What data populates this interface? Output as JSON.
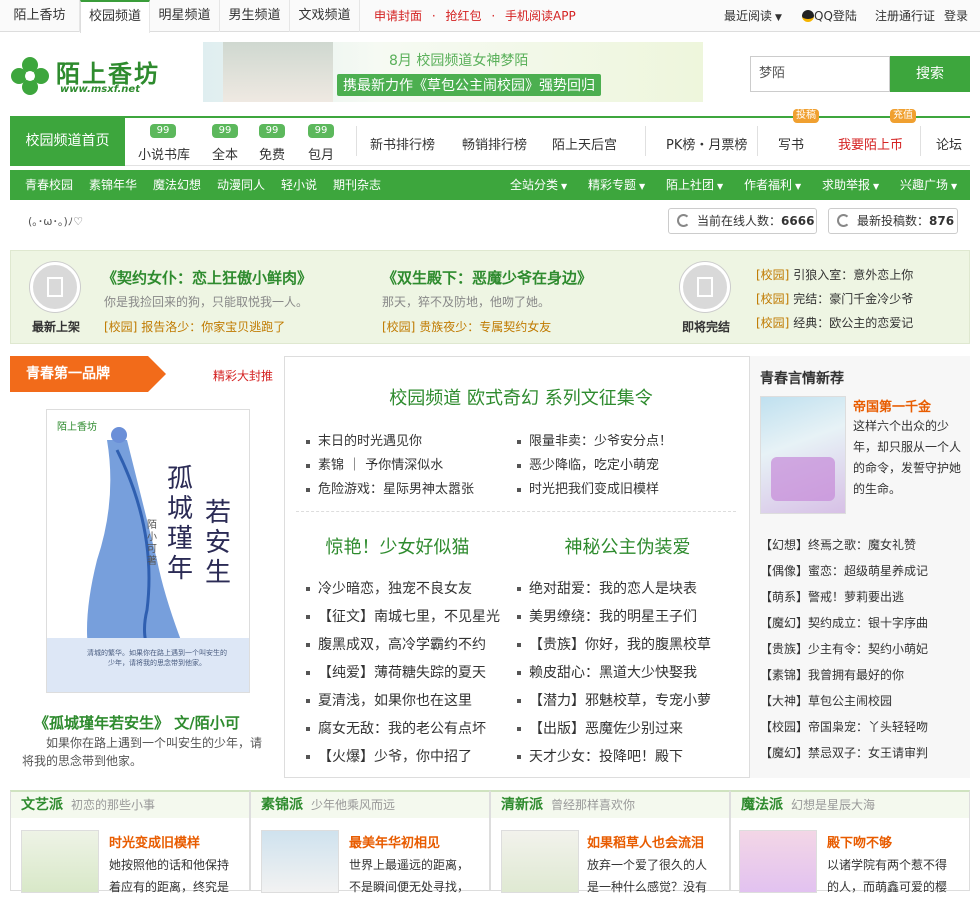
{
  "topbar": {
    "tabs": [
      "陌上香坊",
      "校园频道",
      "明星频道",
      "男生频道",
      "文戏频道"
    ],
    "promo_links": [
      "申请封面",
      "抢红包",
      "手机阅读APP"
    ],
    "right": [
      "最近阅读",
      "QQ登陆",
      "注册通行证",
      "登录"
    ]
  },
  "header": {
    "logo_cn": "陌上香坊",
    "logo_url_text": "www.msxf.net",
    "banner_line1": "8月 校园频道女神梦陌",
    "banner_line2": "携最新力作《草包公主闹校园》强势回归",
    "search_value": "梦陌",
    "search_button": "搜索"
  },
  "nav1": {
    "home": "校园频道首页",
    "items_with_badge": [
      {
        "label": "小说书库",
        "badge": "99"
      },
      {
        "label": "全本",
        "badge": "99"
      },
      {
        "label": "免费",
        "badge": "99"
      },
      {
        "label": "包月",
        "badge": "99"
      }
    ],
    "items": [
      "新书排行榜",
      "畅销排行榜",
      "陌上天后宫",
      "PK榜・月票榜",
      "写书",
      "我要陌上币",
      "论坛"
    ],
    "badge_write": "投稿",
    "badge_coin": "充值"
  },
  "nav2": {
    "left": [
      "青春校园",
      "素锦年华",
      "魔法幻想",
      "动漫同人",
      "轻小说",
      "期刊杂志"
    ],
    "right": [
      "全站分类",
      "精彩专题",
      "陌上社团",
      "作者福利",
      "求助举报",
      "兴趣广场"
    ]
  },
  "status": {
    "emoticon": "(｡･ω･｡)ﾉ♡",
    "online_label": "当前在线人数：",
    "online_count": "6666",
    "posts_label": "最新投稿数：",
    "posts_count": "876"
  },
  "promo": {
    "left_label": "最新上架",
    "right_label": "即将完结",
    "book1_title": "《契约女仆：恋上狂傲小鲜肉》",
    "book1_desc": "你是我捡回来的狗，只能取悦我一人。",
    "book1_tag": "[校园]",
    "book1_tag_text": "报告洛少：你家宝贝逃跑了",
    "book2_title": "《双生殿下：恶魔少爷在身边》",
    "book2_desc": "那天，猝不及防地，他吻了她。",
    "book2_tag": "[校园]",
    "book2_tag_text": "贵族夜少：专属契约女友",
    "right_list": [
      {
        "tag": "[校园]",
        "text": "引狼入室：意外恋上你"
      },
      {
        "tag": "[校园]",
        "text": "完结：豪门千金冷少爷"
      },
      {
        "tag": "[校园]",
        "text": "经典：欧公主的恋爱记"
      }
    ]
  },
  "featured": {
    "ribbon": "青春第一品牌",
    "more": "精彩大封推",
    "cover_publisher": "陌上香坊",
    "cover_title_a": "孤城瑾年",
    "cover_title_b": "若安生",
    "cover_author": "陌小可著",
    "cover_blurb": "清城的繁华。如果你在路上遇到一个叫安生的少年，请将我的思念带到他家。",
    "title": "《孤城瑾年若安生》 文/陌小可",
    "desc": "如果你在路上遇到一个叫安生的少年，请将我的思念带到他家。"
  },
  "center": {
    "heading": "校园频道 欧式奇幻 系列文征集令",
    "list_left": [
      "末日的时光遇见你",
      "素锦 ｜ 予你情深似水",
      "危险游戏：星际男神太嚣张"
    ],
    "list_right": [
      "限量非卖：少爷安分点！",
      "恶少降临，吃定小萌宠",
      "时光把我们变成旧模样"
    ],
    "sub_left": "惊艳！少女好似猫",
    "sub_right": "神秘公主伪装爱",
    "col_left": [
      "冷少暗恋，独宠不良女友",
      "【征文】南城七里，不见星光",
      "腹黑成双，高冷学霸约不约",
      "【纯爱】薄荷糖失踪的夏天",
      "夏清浅，如果你也在这里",
      "腐女无敌：我的老公有点坏",
      "【火爆】少爷，你中招了"
    ],
    "col_right": [
      "绝对甜爱：我的恋人是块表",
      "美男缭绕：我的明星王子们",
      "【贵族】你好，我的腹黑校草",
      "赖皮甜心：黑道大少快娶我",
      "【潜力】邪魅校草，专宠小萝",
      "【出版】恶魔佐少别过来",
      "天才少女：投降吧！殿下"
    ]
  },
  "right": {
    "heading": "青春言情新荐",
    "book_title": "帝国第一千金",
    "book_desc": "这样六个出众的少年，却只服从一个人的命令，发誓守护她的生命。",
    "list": [
      {
        "text": "【幻想】终焉之歌：魔女礼赞",
        "hot": false
      },
      {
        "text": "【偶像】蜜恋：超级萌星养成记",
        "hot": false
      },
      {
        "text": "【萌系】警戒！萝莉要出逃",
        "hot": true
      },
      {
        "text": "【魔幻】契约成立：银十字序曲",
        "hot": false
      },
      {
        "text": "【贵族】少主有令：契约小萌妃",
        "hot": false
      },
      {
        "text": "【素锦】我曾拥有最好的你",
        "hot": false
      },
      {
        "text": "【大神】草包公主闹校园",
        "hot": true
      },
      {
        "text": "【校园】帝国枭宠：丫头轻轻吻",
        "hot": false
      },
      {
        "text": "【魔幻】禁忌双子：女王请审判",
        "hot": false
      }
    ]
  },
  "bottom": [
    {
      "name": "文艺派",
      "sub": "初恋的那些小事",
      "title": "时光变成旧模样",
      "desc": [
        "她按照他的话和他保持",
        "着应有的距离，终究是"
      ]
    },
    {
      "name": "素锦派",
      "sub": "少年他乘风而远",
      "title": "最美年华初相见",
      "desc": [
        "世界上最遥远的距离，",
        "不是瞬间便无处寻找，"
      ]
    },
    {
      "name": "清新派",
      "sub": "曾经那样喜欢你",
      "title": "如果稻草人也会流泪",
      "desc": [
        "放弃一个爱了很久的人",
        "是一种什么感觉？没有"
      ]
    },
    {
      "name": "魔法派",
      "sub": "幻想是星辰大海",
      "title": "殿下吻不够",
      "desc": [
        "以诸学院有两个惹不得",
        "的人，而萌鑫可爱的樱"
      ]
    }
  ],
  "colors": {
    "brand_green": "#3da63d",
    "accent_orange": "#f26b1a",
    "hot_red": "#d42222",
    "tag_gold": "#c07a00"
  }
}
